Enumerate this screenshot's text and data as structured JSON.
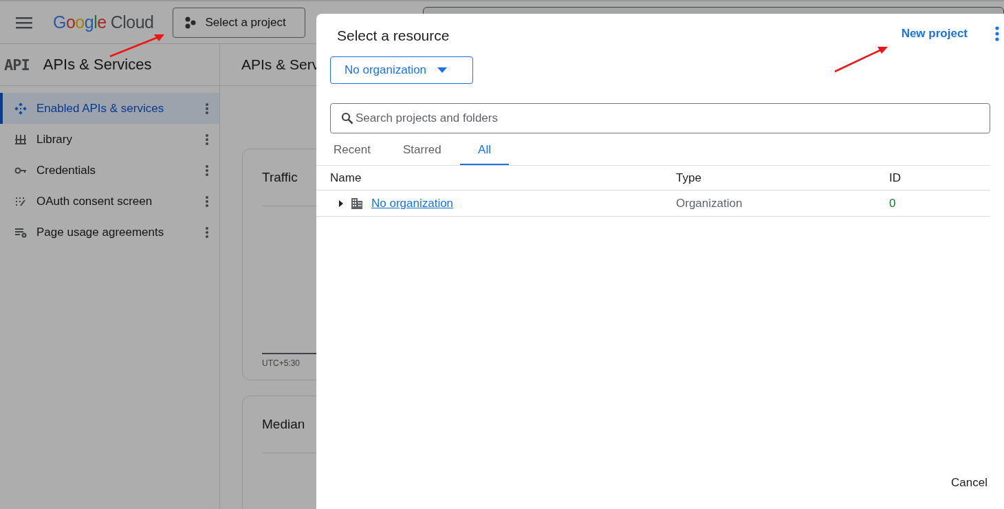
{
  "top_bar": {
    "logo": {
      "brand": "Google",
      "product": "Cloud"
    },
    "project_button": "Select a project"
  },
  "sidebar": {
    "badge": "API",
    "title": "APIs & Services",
    "items": [
      {
        "label": "Enabled APIs & services",
        "kind": "enabled",
        "selected": true
      },
      {
        "label": "Library",
        "kind": "library",
        "selected": false
      },
      {
        "label": "Credentials",
        "kind": "credentials",
        "selected": false
      },
      {
        "label": "OAuth consent screen",
        "kind": "consent",
        "selected": false
      },
      {
        "label": "Page usage agreements",
        "kind": "agreements",
        "selected": false
      }
    ]
  },
  "main": {
    "title": "APIs & Serv",
    "cards": [
      {
        "title": "Traffic",
        "footer": "UTC+5:30"
      },
      {
        "title": "Median"
      }
    ]
  },
  "dialog": {
    "title": "Select a resource",
    "new_project": "New project",
    "organization_dropdown": "No organization",
    "search": {
      "placeholder": "Search projects and folders"
    },
    "tabs": [
      {
        "label": "Recent",
        "selected": false
      },
      {
        "label": "Starred",
        "selected": false
      },
      {
        "label": "All",
        "selected": true
      }
    ],
    "table": {
      "columns": [
        "Name",
        "Type",
        "ID"
      ],
      "rows": [
        {
          "name": "No organization",
          "type": "Organization",
          "id": "0",
          "expanded": false
        }
      ]
    },
    "cancel": "Cancel"
  }
}
